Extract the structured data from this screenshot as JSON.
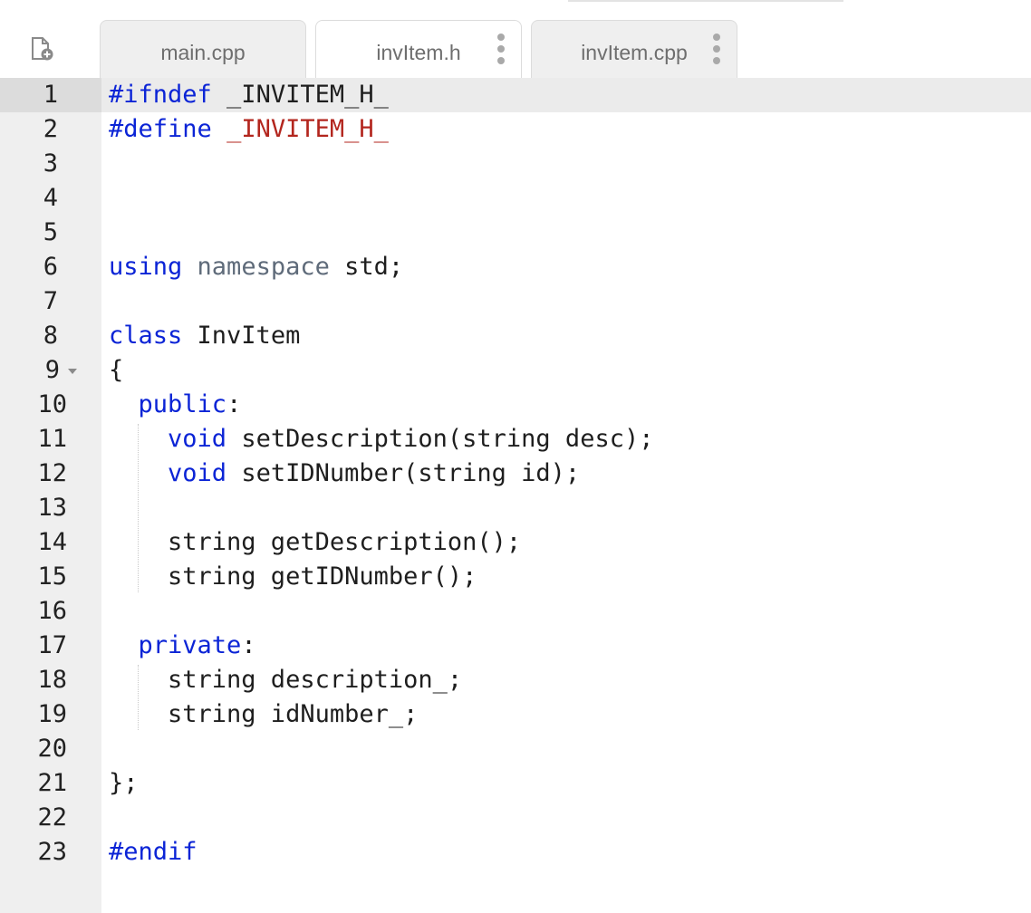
{
  "tabs": [
    {
      "label": "main.cpp",
      "active": false,
      "has_menu": false
    },
    {
      "label": "invItem.h",
      "active": true,
      "has_menu": true
    },
    {
      "label": "invItem.cpp",
      "active": false,
      "has_menu": true
    }
  ],
  "toolbar": {
    "new_file_icon": "new-file-icon"
  },
  "editor": {
    "active_line": 1,
    "folded_marker_line": 9,
    "line_numbers": [
      "1",
      "2",
      "3",
      "4",
      "5",
      "6",
      "7",
      "8",
      "9",
      "10",
      "11",
      "12",
      "13",
      "14",
      "15",
      "16",
      "17",
      "18",
      "19",
      "20",
      "21",
      "22",
      "23"
    ],
    "lines": [
      {
        "tokens": [
          {
            "t": "#ifndef",
            "c": "kw-blue"
          },
          {
            "t": " _INVITEM_H_",
            "c": ""
          }
        ]
      },
      {
        "tokens": [
          {
            "t": "#define",
            "c": "kw-blue"
          },
          {
            "t": " ",
            "c": ""
          },
          {
            "t": "_INVITEM_H_",
            "c": "macro-red"
          }
        ]
      },
      {
        "tokens": []
      },
      {
        "tokens": []
      },
      {
        "tokens": []
      },
      {
        "tokens": [
          {
            "t": "using",
            "c": "kw-blue"
          },
          {
            "t": " ",
            "c": ""
          },
          {
            "t": "namespace",
            "c": "kw-gray"
          },
          {
            "t": " std;",
            "c": ""
          }
        ]
      },
      {
        "tokens": []
      },
      {
        "tokens": [
          {
            "t": "class",
            "c": "kw-blue"
          },
          {
            "t": " InvItem",
            "c": ""
          }
        ]
      },
      {
        "tokens": [
          {
            "t": "{",
            "c": ""
          }
        ]
      },
      {
        "tokens": [
          {
            "t": "  ",
            "c": ""
          },
          {
            "t": "public",
            "c": "kw-blue"
          },
          {
            "t": ":",
            "c": ""
          }
        ]
      },
      {
        "tokens": [
          {
            "t": "    ",
            "c": ""
          },
          {
            "t": "void",
            "c": "kw-blue"
          },
          {
            "t": " setDescription(string desc);",
            "c": ""
          }
        ]
      },
      {
        "tokens": [
          {
            "t": "    ",
            "c": ""
          },
          {
            "t": "void",
            "c": "kw-blue"
          },
          {
            "t": " setIDNumber(string id);",
            "c": ""
          }
        ]
      },
      {
        "tokens": []
      },
      {
        "tokens": [
          {
            "t": "    string getDescription();",
            "c": ""
          }
        ]
      },
      {
        "tokens": [
          {
            "t": "    string getIDNumber();",
            "c": ""
          }
        ]
      },
      {
        "tokens": []
      },
      {
        "tokens": [
          {
            "t": "  ",
            "c": ""
          },
          {
            "t": "private",
            "c": "kw-blue"
          },
          {
            "t": ":",
            "c": ""
          }
        ]
      },
      {
        "tokens": [
          {
            "t": "    string description_;",
            "c": ""
          }
        ]
      },
      {
        "tokens": [
          {
            "t": "    string idNumber_;",
            "c": ""
          }
        ]
      },
      {
        "tokens": []
      },
      {
        "tokens": [
          {
            "t": "};",
            "c": ""
          }
        ]
      },
      {
        "tokens": []
      },
      {
        "tokens": [
          {
            "t": "#endif",
            "c": "kw-blue"
          }
        ]
      }
    ]
  }
}
